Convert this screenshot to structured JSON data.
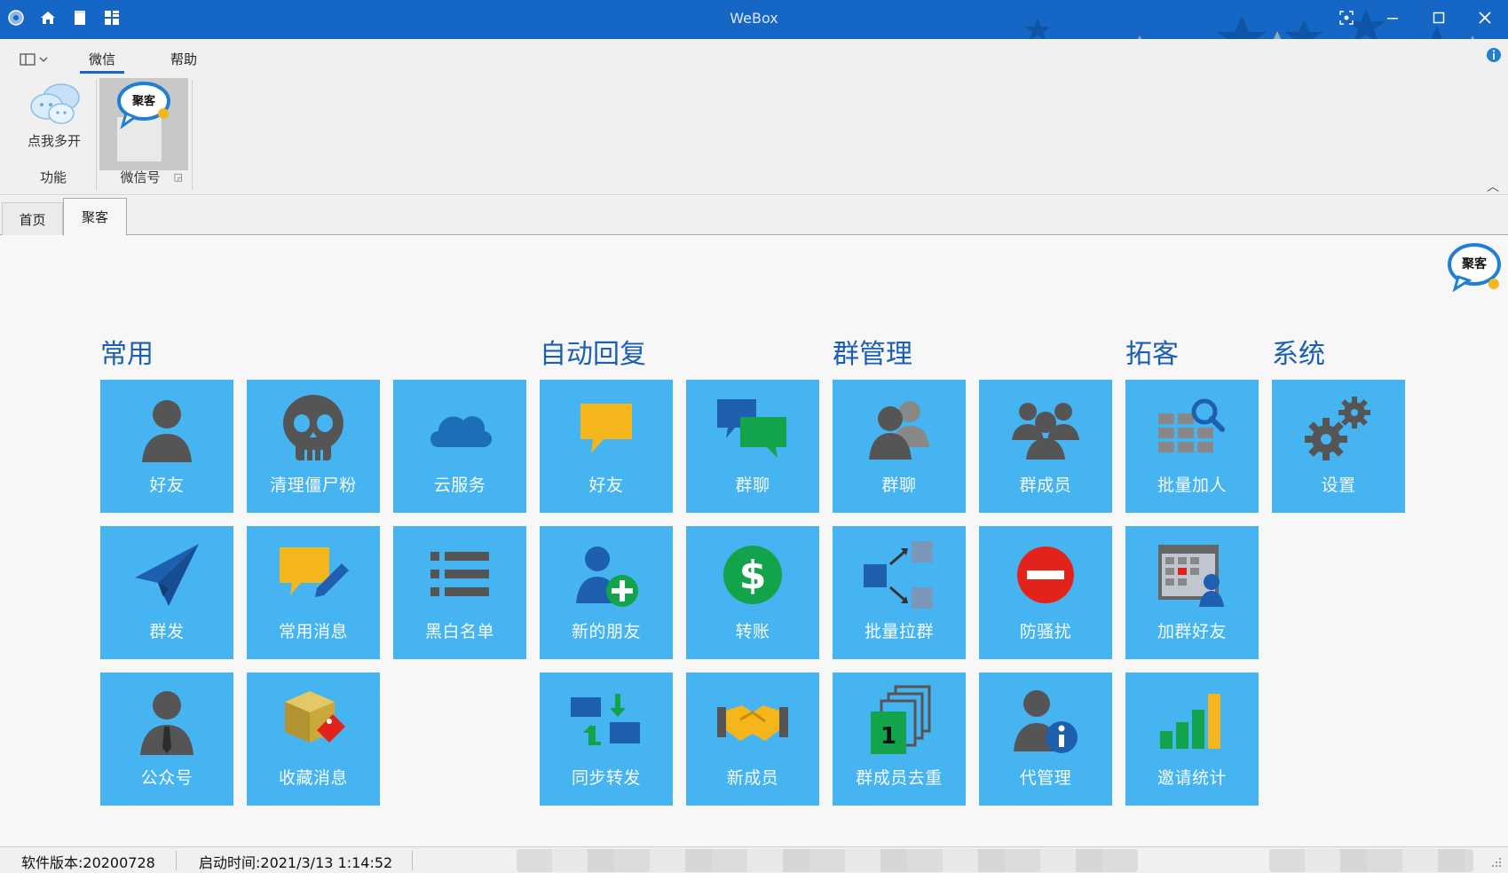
{
  "app": {
    "title": "WeBox"
  },
  "ribbon": {
    "tabs": [
      "微信",
      "帮助"
    ],
    "group_function": {
      "button_label": "点我多开",
      "label": "功能"
    },
    "group_wechat": {
      "label": "微信号"
    }
  },
  "doc_tabs": [
    "首页",
    "聚客"
  ],
  "sections": {
    "common": "常用",
    "auto_reply": "自动回复",
    "group_mgmt": "群管理",
    "tuoke": "拓客",
    "system": "系统"
  },
  "tiles": {
    "friend": "好友",
    "clean_zombie": "清理僵尸粉",
    "cloud": "云服务",
    "ar_friend": "好友",
    "ar_group": "群聊",
    "gm_group": "群聊",
    "gm_members": "群成员",
    "batch_add": "批量加人",
    "settings": "设置",
    "mass_send": "群发",
    "common_msg": "常用消息",
    "blackwhite": "黑白名单",
    "new_friend": "新的朋友",
    "transfer": "转账",
    "batch_pull": "批量拉群",
    "anti_harass": "防骚扰",
    "add_group_friend": "加群好友",
    "official": "公众号",
    "fav_msg": "收藏消息",
    "sync_forward": "同步转发",
    "new_member": "新成员",
    "dedup": "群成员去重",
    "proxy_admin": "代管理",
    "invite_stats": "邀请统计"
  },
  "statusbar": {
    "version": "软件版本:20200728",
    "start_time": "启动时间:2021/3/13 1:14:52"
  },
  "colors": {
    "titlebar": "#1566c5",
    "tile": "#47b4f2",
    "section_title": "#1a5fb4"
  }
}
